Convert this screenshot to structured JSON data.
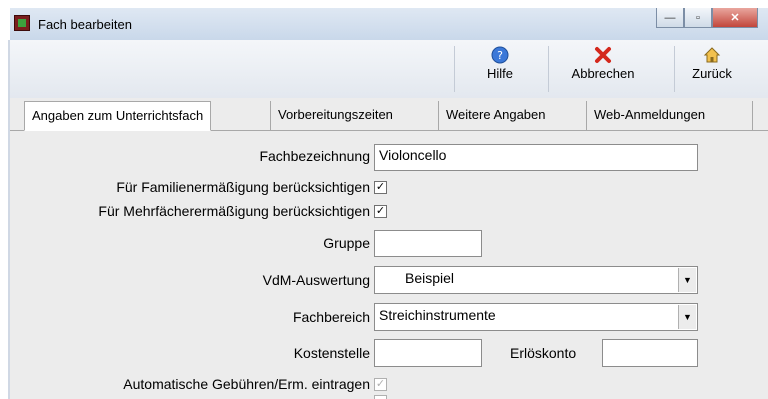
{
  "window": {
    "title": "Fach bearbeiten"
  },
  "toolbar": {
    "help_label": "Hilfe",
    "cancel_label": "Abbrechen",
    "back_label": "Zurück"
  },
  "tabs": [
    {
      "label": "Angaben zum Unterrichtsfach"
    },
    {
      "label": "Vorbereitungszeiten"
    },
    {
      "label": "Weitere Angaben"
    },
    {
      "label": "Web-Anmeldungen"
    }
  ],
  "form": {
    "fachbezeichnung_label": "Fachbezeichnung",
    "fachbezeichnung_value": "Violoncello",
    "familien_label": "Für Familienermäßigung berücksichtigen",
    "mehrfach_label": "Für Mehrfächerermäßigung berücksichtigen",
    "gruppe_label": "Gruppe",
    "gruppe_value": "",
    "vdm_label": "VdM-Auswertung",
    "vdm_value": "Beispiel",
    "fachbereich_label": "Fachbereich",
    "fachbereich_value": "Streichinstrumente",
    "kostenstelle_label": "Kostenstelle",
    "kostenstelle_value": "",
    "erloeskonto_label": "Erlöskonto",
    "erloeskonto_value": "",
    "auto_label": "Automatische Gebühren/Erm. eintragen",
    "checked_glyph": "✓"
  }
}
